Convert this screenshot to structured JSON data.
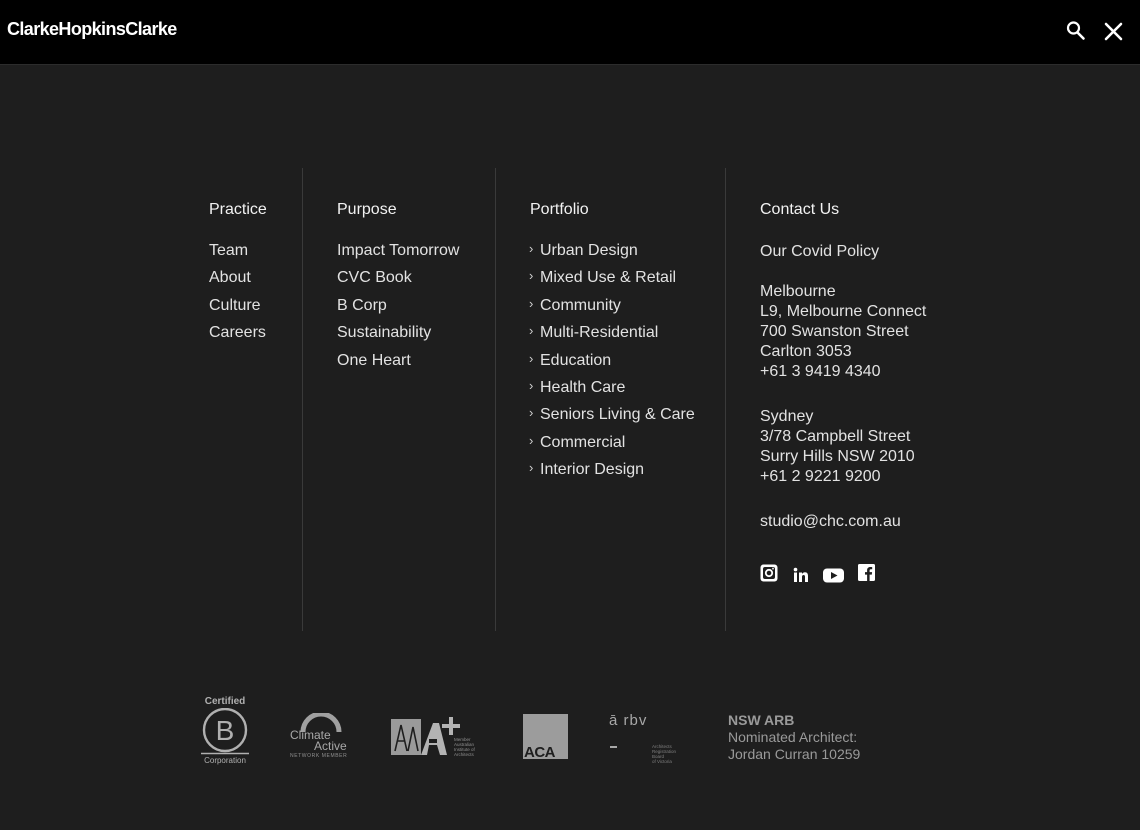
{
  "header": {
    "logo_text": "ClarkeHopkinsClarke",
    "search_icon": "search-icon",
    "close_icon": "close-icon"
  },
  "columns": {
    "practice": {
      "title": "Practice",
      "items": [
        "Team",
        "About",
        "Culture",
        "Careers"
      ]
    },
    "purpose": {
      "title": "Purpose",
      "items": [
        "Impact Tomorrow",
        "CVC Book",
        "B Corp",
        "Sustainability",
        "One Heart"
      ]
    },
    "portfolio": {
      "title": "Portfolio",
      "items": [
        "Urban Design",
        "Mixed Use & Retail",
        "Community",
        "Multi-Residential",
        "Education",
        "Health Care",
        "Seniors Living & Care",
        "Commercial",
        "Interior Design"
      ]
    },
    "contact": {
      "title": "Contact Us",
      "covid_link": "Our Covid Policy",
      "melbourne": [
        "Melbourne",
        "L9, Melbourne Connect",
        "700 Swanston Street",
        "Carlton 3053",
        "+61 3 9419 4340"
      ],
      "sydney": [
        "Sydney",
        "3/78 Campbell Street",
        "Surry Hills NSW 2010",
        "+61 2 9221 9200"
      ],
      "email": "studio@chc.com.au",
      "social_icons": [
        "instagram-icon",
        "linkedin-icon",
        "youtube-icon",
        "facebook-icon"
      ]
    }
  },
  "badges": {
    "bcorp_top": "Certified",
    "bcorp_letter": "B",
    "bcorp_bottom": "Corporation",
    "climate_line1": "Climate",
    "climate_line2": "Active",
    "climate_line3": "NETWORK MEMBER",
    "aia_line1": "Member",
    "aia_line2": "Australian",
    "aia_line3": "Institute of",
    "aia_line4": "Architects",
    "aca_text": "ACA",
    "arbv_text": "ā rbv",
    "arbv_line1": "Architects",
    "arbv_line2": "Registration Board",
    "arbv_line3": "of Victoria",
    "nsw_title": "NSW ARB",
    "nsw_line1": "Nominated Architect:",
    "nsw_line2": "Jordan Curran 10259"
  },
  "colors": {
    "background": "#1e1e1e",
    "header": "#000000",
    "text": "#ececec",
    "muted": "#a8a8a8"
  }
}
